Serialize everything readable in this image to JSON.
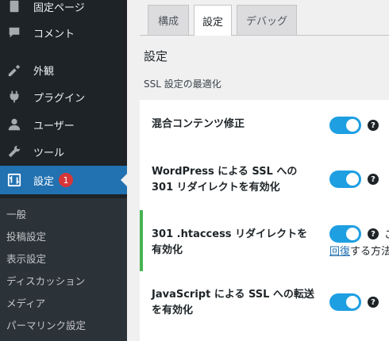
{
  "sidebar": {
    "menu": [
      {
        "label": "固定ページ",
        "icon": "pages-icon"
      },
      {
        "label": "コメント",
        "icon": "comment-icon"
      },
      {
        "label": "外観",
        "icon": "appearance-icon"
      },
      {
        "label": "プラグイン",
        "icon": "plugin-icon"
      },
      {
        "label": "ユーザー",
        "icon": "user-icon"
      },
      {
        "label": "ツール",
        "icon": "tools-icon"
      },
      {
        "label": "設定",
        "icon": "settings-icon",
        "badge": "1"
      }
    ],
    "submenu": [
      "一般",
      "投稿設定",
      "表示設定",
      "ディスカッション",
      "メディア",
      "パーマリンク設定"
    ]
  },
  "tabs": [
    "構成",
    "設定",
    "デバッグ"
  ],
  "page_title": "設定",
  "section_title": "SSL 設定の最適化",
  "rows": [
    {
      "label_lines": [
        "混合コンテンツ修正"
      ],
      "enabled": true
    },
    {
      "label_lines": [
        "WordPress による SSL への",
        "301 リダイレクトを有効化"
      ],
      "enabled": true
    },
    {
      "label_lines": [
        "301 .htaccess リダイレクトを",
        "有効化"
      ],
      "enabled": true,
      "note_trunc": "こ",
      "recover_link": "回復",
      "recover_rest": "する方法"
    },
    {
      "label_lines": [
        "JavaScript による SSL への転送",
        "を有効化"
      ],
      "enabled": true
    }
  ],
  "help_glyph": "?",
  "colors": {
    "sidebar": "#1d2327",
    "active": "#2271b1",
    "toggle": "#1e9fe2",
    "highlight": "#46b450",
    "badge": "#d63638"
  }
}
